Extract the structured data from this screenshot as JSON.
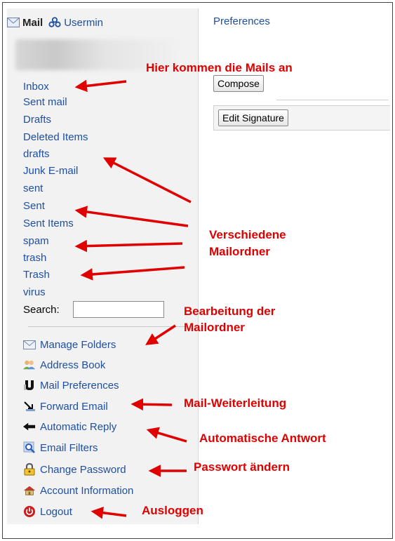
{
  "header": {
    "mail_label": "Mail",
    "usermin_label": "Usermin",
    "preferences_label": "Preferences"
  },
  "folders": [
    "Inbox",
    "Sent mail",
    "Drafts",
    "Deleted Items",
    "drafts",
    "Junk E-mail",
    "sent",
    "Sent",
    "Sent Items",
    "spam",
    "trash",
    "Trash",
    "virus"
  ],
  "search": {
    "label": "Search:",
    "value": ""
  },
  "menu": [
    {
      "label": "Manage Folders",
      "icon": "envelope-icon"
    },
    {
      "label": "Address Book",
      "icon": "contacts-icon"
    },
    {
      "label": "Mail Preferences",
      "icon": "preferences-icon"
    },
    {
      "label": "Forward Email",
      "icon": "forward-icon"
    },
    {
      "label": "Automatic Reply",
      "icon": "reply-icon"
    },
    {
      "label": "Email Filters",
      "icon": "filter-icon"
    },
    {
      "label": "Change Password",
      "icon": "lock-icon"
    },
    {
      "label": "Account Information",
      "icon": "home-icon"
    },
    {
      "label": "Logout",
      "icon": "power-icon"
    }
  ],
  "buttons": {
    "compose": "Compose",
    "edit_signature": "Edit Signature"
  },
  "annotations": {
    "inbox": "Hier kommen die Mails an",
    "folders_line1": "Verschiedene",
    "folders_line2": "Mailordner",
    "manage_line1": "Bearbeitung der",
    "manage_line2": "Mailordner",
    "forward": "Mail-Weiterleitung",
    "reply": "Automatische Antwort",
    "password": "Passwort ändern",
    "logout": "Ausloggen"
  },
  "colors": {
    "link": "#1f4fa0",
    "annotation": "#e00000",
    "sidebar_bg": "#f2f2f2"
  }
}
